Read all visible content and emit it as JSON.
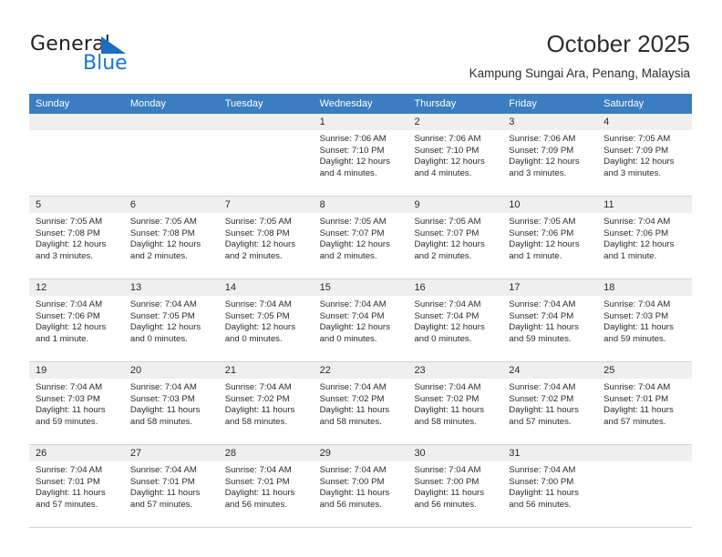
{
  "brand": {
    "word1": "General",
    "word2": "Blue",
    "triangle_color": "#1b6ec2",
    "blue_color": "#1b76d2"
  },
  "header": {
    "title": "October 2025",
    "subtitle": "Kampung Sungai Ara, Penang, Malaysia",
    "header_bg": "#3a7dc0",
    "daynum_bg": "#efefef"
  },
  "weekdays": [
    "Sunday",
    "Monday",
    "Tuesday",
    "Wednesday",
    "Thursday",
    "Friday",
    "Saturday"
  ],
  "weeks": [
    [
      {
        "day": "",
        "sunrise": "",
        "sunset": "",
        "daylight1": "",
        "daylight2": ""
      },
      {
        "day": "",
        "sunrise": "",
        "sunset": "",
        "daylight1": "",
        "daylight2": ""
      },
      {
        "day": "",
        "sunrise": "",
        "sunset": "",
        "daylight1": "",
        "daylight2": ""
      },
      {
        "day": "1",
        "sunrise": "Sunrise: 7:06 AM",
        "sunset": "Sunset: 7:10 PM",
        "daylight1": "Daylight: 12 hours",
        "daylight2": "and 4 minutes."
      },
      {
        "day": "2",
        "sunrise": "Sunrise: 7:06 AM",
        "sunset": "Sunset: 7:10 PM",
        "daylight1": "Daylight: 12 hours",
        "daylight2": "and 4 minutes."
      },
      {
        "day": "3",
        "sunrise": "Sunrise: 7:06 AM",
        "sunset": "Sunset: 7:09 PM",
        "daylight1": "Daylight: 12 hours",
        "daylight2": "and 3 minutes."
      },
      {
        "day": "4",
        "sunrise": "Sunrise: 7:05 AM",
        "sunset": "Sunset: 7:09 PM",
        "daylight1": "Daylight: 12 hours",
        "daylight2": "and 3 minutes."
      }
    ],
    [
      {
        "day": "5",
        "sunrise": "Sunrise: 7:05 AM",
        "sunset": "Sunset: 7:08 PM",
        "daylight1": "Daylight: 12 hours",
        "daylight2": "and 3 minutes."
      },
      {
        "day": "6",
        "sunrise": "Sunrise: 7:05 AM",
        "sunset": "Sunset: 7:08 PM",
        "daylight1": "Daylight: 12 hours",
        "daylight2": "and 2 minutes."
      },
      {
        "day": "7",
        "sunrise": "Sunrise: 7:05 AM",
        "sunset": "Sunset: 7:08 PM",
        "daylight1": "Daylight: 12 hours",
        "daylight2": "and 2 minutes."
      },
      {
        "day": "8",
        "sunrise": "Sunrise: 7:05 AM",
        "sunset": "Sunset: 7:07 PM",
        "daylight1": "Daylight: 12 hours",
        "daylight2": "and 2 minutes."
      },
      {
        "day": "9",
        "sunrise": "Sunrise: 7:05 AM",
        "sunset": "Sunset: 7:07 PM",
        "daylight1": "Daylight: 12 hours",
        "daylight2": "and 2 minutes."
      },
      {
        "day": "10",
        "sunrise": "Sunrise: 7:05 AM",
        "sunset": "Sunset: 7:06 PM",
        "daylight1": "Daylight: 12 hours",
        "daylight2": "and 1 minute."
      },
      {
        "day": "11",
        "sunrise": "Sunrise: 7:04 AM",
        "sunset": "Sunset: 7:06 PM",
        "daylight1": "Daylight: 12 hours",
        "daylight2": "and 1 minute."
      }
    ],
    [
      {
        "day": "12",
        "sunrise": "Sunrise: 7:04 AM",
        "sunset": "Sunset: 7:06 PM",
        "daylight1": "Daylight: 12 hours",
        "daylight2": "and 1 minute."
      },
      {
        "day": "13",
        "sunrise": "Sunrise: 7:04 AM",
        "sunset": "Sunset: 7:05 PM",
        "daylight1": "Daylight: 12 hours",
        "daylight2": "and 0 minutes."
      },
      {
        "day": "14",
        "sunrise": "Sunrise: 7:04 AM",
        "sunset": "Sunset: 7:05 PM",
        "daylight1": "Daylight: 12 hours",
        "daylight2": "and 0 minutes."
      },
      {
        "day": "15",
        "sunrise": "Sunrise: 7:04 AM",
        "sunset": "Sunset: 7:04 PM",
        "daylight1": "Daylight: 12 hours",
        "daylight2": "and 0 minutes."
      },
      {
        "day": "16",
        "sunrise": "Sunrise: 7:04 AM",
        "sunset": "Sunset: 7:04 PM",
        "daylight1": "Daylight: 12 hours",
        "daylight2": "and 0 minutes."
      },
      {
        "day": "17",
        "sunrise": "Sunrise: 7:04 AM",
        "sunset": "Sunset: 7:04 PM",
        "daylight1": "Daylight: 11 hours",
        "daylight2": "and 59 minutes."
      },
      {
        "day": "18",
        "sunrise": "Sunrise: 7:04 AM",
        "sunset": "Sunset: 7:03 PM",
        "daylight1": "Daylight: 11 hours",
        "daylight2": "and 59 minutes."
      }
    ],
    [
      {
        "day": "19",
        "sunrise": "Sunrise: 7:04 AM",
        "sunset": "Sunset: 7:03 PM",
        "daylight1": "Daylight: 11 hours",
        "daylight2": "and 59 minutes."
      },
      {
        "day": "20",
        "sunrise": "Sunrise: 7:04 AM",
        "sunset": "Sunset: 7:03 PM",
        "daylight1": "Daylight: 11 hours",
        "daylight2": "and 58 minutes."
      },
      {
        "day": "21",
        "sunrise": "Sunrise: 7:04 AM",
        "sunset": "Sunset: 7:02 PM",
        "daylight1": "Daylight: 11 hours",
        "daylight2": "and 58 minutes."
      },
      {
        "day": "22",
        "sunrise": "Sunrise: 7:04 AM",
        "sunset": "Sunset: 7:02 PM",
        "daylight1": "Daylight: 11 hours",
        "daylight2": "and 58 minutes."
      },
      {
        "day": "23",
        "sunrise": "Sunrise: 7:04 AM",
        "sunset": "Sunset: 7:02 PM",
        "daylight1": "Daylight: 11 hours",
        "daylight2": "and 58 minutes."
      },
      {
        "day": "24",
        "sunrise": "Sunrise: 7:04 AM",
        "sunset": "Sunset: 7:02 PM",
        "daylight1": "Daylight: 11 hours",
        "daylight2": "and 57 minutes."
      },
      {
        "day": "25",
        "sunrise": "Sunrise: 7:04 AM",
        "sunset": "Sunset: 7:01 PM",
        "daylight1": "Daylight: 11 hours",
        "daylight2": "and 57 minutes."
      }
    ],
    [
      {
        "day": "26",
        "sunrise": "Sunrise: 7:04 AM",
        "sunset": "Sunset: 7:01 PM",
        "daylight1": "Daylight: 11 hours",
        "daylight2": "and 57 minutes."
      },
      {
        "day": "27",
        "sunrise": "Sunrise: 7:04 AM",
        "sunset": "Sunset: 7:01 PM",
        "daylight1": "Daylight: 11 hours",
        "daylight2": "and 57 minutes."
      },
      {
        "day": "28",
        "sunrise": "Sunrise: 7:04 AM",
        "sunset": "Sunset: 7:01 PM",
        "daylight1": "Daylight: 11 hours",
        "daylight2": "and 56 minutes."
      },
      {
        "day": "29",
        "sunrise": "Sunrise: 7:04 AM",
        "sunset": "Sunset: 7:00 PM",
        "daylight1": "Daylight: 11 hours",
        "daylight2": "and 56 minutes."
      },
      {
        "day": "30",
        "sunrise": "Sunrise: 7:04 AM",
        "sunset": "Sunset: 7:00 PM",
        "daylight1": "Daylight: 11 hours",
        "daylight2": "and 56 minutes."
      },
      {
        "day": "31",
        "sunrise": "Sunrise: 7:04 AM",
        "sunset": "Sunset: 7:00 PM",
        "daylight1": "Daylight: 11 hours",
        "daylight2": "and 56 minutes."
      },
      {
        "day": "",
        "sunrise": "",
        "sunset": "",
        "daylight1": "",
        "daylight2": ""
      }
    ]
  ]
}
